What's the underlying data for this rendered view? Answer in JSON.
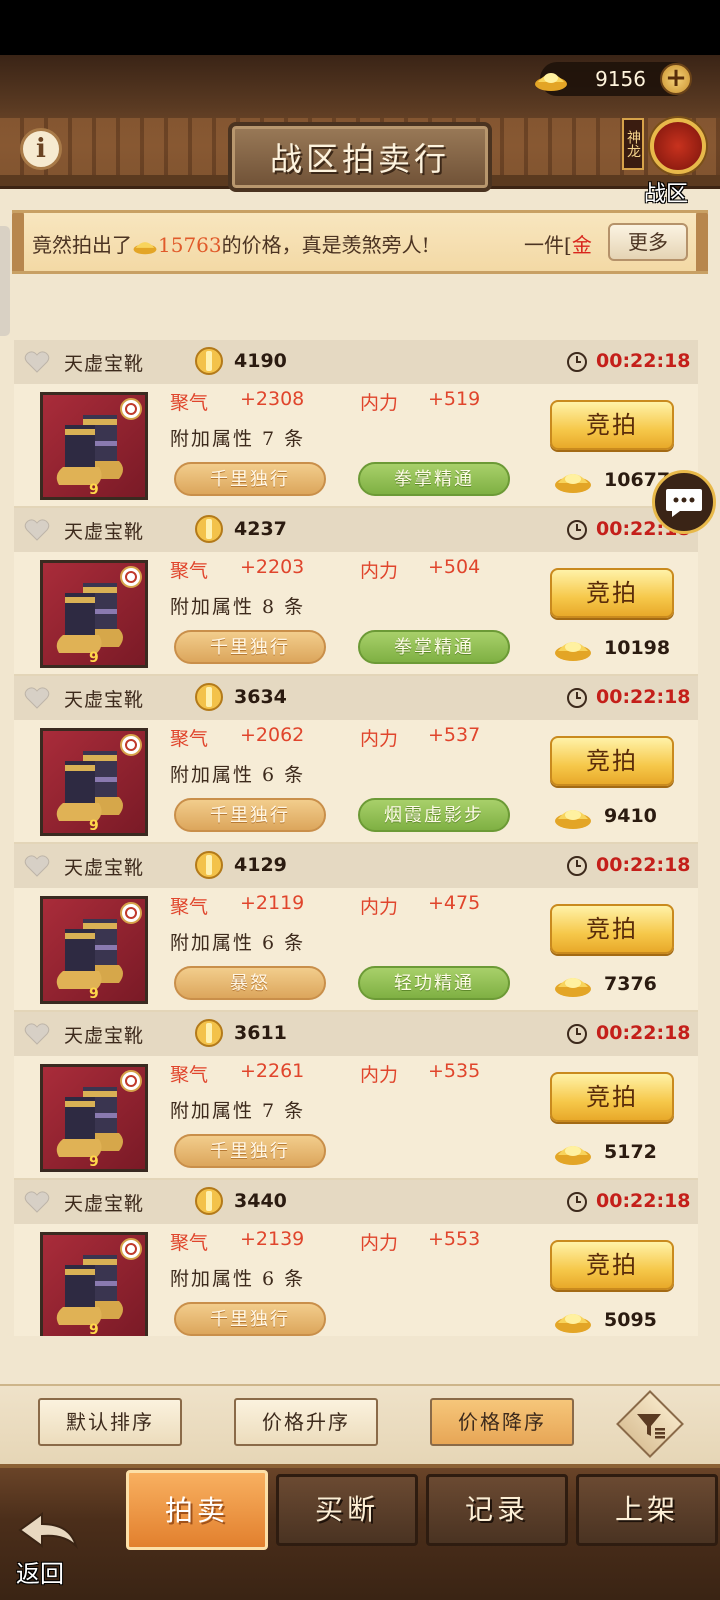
{
  "header": {
    "title": "战区拍卖行",
    "currency_amount": "9156",
    "zone_tag": "神龙",
    "zone_label": "战区"
  },
  "marquee": {
    "text_prefix": "竟然拍出了",
    "amount": "15763",
    "text_suffix": "的价格，真是羡煞旁人!",
    "text_next_prefix": "一件[",
    "text_next_red": "金",
    "more_label": "更多"
  },
  "items": [
    {
      "name": "天虚宝靴",
      "score": "4190",
      "timer": "00:22:18",
      "stat1_label": "聚气",
      "stat1_value": "+2308",
      "stat2_label": "内力",
      "stat2_value": "+519",
      "extra": "附加属性 7 条",
      "tag1": "千里独行",
      "tag2": "拳掌精通",
      "bid_label": "竞拍",
      "price": "10677"
    },
    {
      "name": "天虚宝靴",
      "score": "4237",
      "timer": "00:22:18",
      "stat1_label": "聚气",
      "stat1_value": "+2203",
      "stat2_label": "内力",
      "stat2_value": "+504",
      "extra": "附加属性 8 条",
      "tag1": "千里独行",
      "tag2": "拳掌精通",
      "bid_label": "竞拍",
      "price": "10198"
    },
    {
      "name": "天虚宝靴",
      "score": "3634",
      "timer": "00:22:18",
      "stat1_label": "聚气",
      "stat1_value": "+2062",
      "stat2_label": "内力",
      "stat2_value": "+537",
      "extra": "附加属性 6 条",
      "tag1": "千里独行",
      "tag2": "烟霞虚影步",
      "bid_label": "竞拍",
      "price": "9410"
    },
    {
      "name": "天虚宝靴",
      "score": "4129",
      "timer": "00:22:18",
      "stat1_label": "聚气",
      "stat1_value": "+2119",
      "stat2_label": "内力",
      "stat2_value": "+475",
      "extra": "附加属性 6 条",
      "tag1": "暴怒",
      "tag2": "轻功精通",
      "bid_label": "竞拍",
      "price": "7376"
    },
    {
      "name": "天虚宝靴",
      "score": "3611",
      "timer": "00:22:18",
      "stat1_label": "聚气",
      "stat1_value": "+2261",
      "stat2_label": "内力",
      "stat2_value": "+535",
      "extra": "附加属性 7 条",
      "tag1": "千里独行",
      "tag2": "",
      "bid_label": "竞拍",
      "price": "5172"
    },
    {
      "name": "天虚宝靴",
      "score": "3440",
      "timer": "00:22:18",
      "stat1_label": "聚气",
      "stat1_value": "+2139",
      "stat2_label": "内力",
      "stat2_value": "+553",
      "extra": "附加属性 6 条",
      "tag1": "千里独行",
      "tag2": "",
      "bid_label": "竞拍",
      "price": "5095"
    }
  ],
  "sort": {
    "default": "默认排序",
    "price_asc": "价格升序",
    "price_desc": "价格降序",
    "active": "price_desc"
  },
  "tabs": {
    "auction": "拍卖",
    "buyout": "买断",
    "records": "记录",
    "list": "上架",
    "active": "auction"
  },
  "back_label": "返回",
  "icons": [
    "info-icon",
    "gold-ingot-icon",
    "plus-icon",
    "dragon-emblem-icon",
    "heart-icon",
    "medal-icon",
    "clock-icon",
    "boots-icon",
    "chat-icon",
    "filter-icon",
    "back-arrow-icon"
  ],
  "colors": {
    "accent_gold": "#f6c84a",
    "timer_red": "#c41f1a",
    "stat_red": "#e0452c",
    "tab_active": "#e2802e"
  }
}
